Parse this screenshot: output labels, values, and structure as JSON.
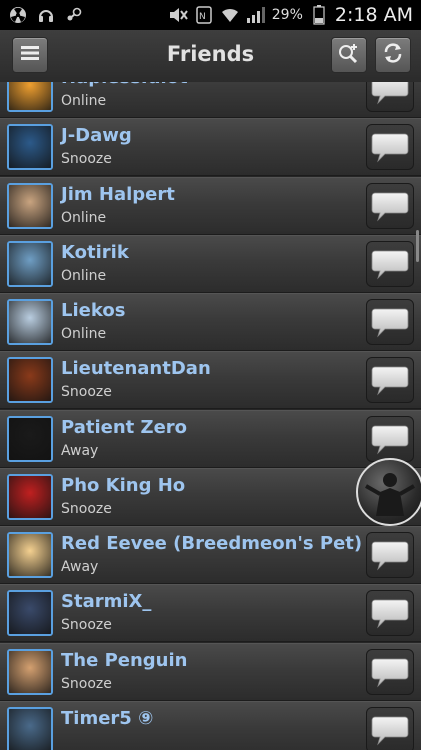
{
  "status_bar": {
    "left_icons": [
      "radiation-icon",
      "headset-icon",
      "steam-icon"
    ],
    "right_icons": [
      "mute-icon",
      "nfc-icon",
      "wifi-icon",
      "signal-icon"
    ],
    "battery_percent": "29%",
    "time": "2:18 AM"
  },
  "app_bar": {
    "title": "Friends",
    "menu_icon": "menu-icon",
    "search_add_icon": "search-add-icon",
    "refresh_icon": "refresh-icon"
  },
  "friends": [
    {
      "name": "HaplessIdiot",
      "status": "Online",
      "avatar_color": "#f0a030"
    },
    {
      "name": "J-Dawg",
      "status": "Snooze",
      "avatar_color": "#2c5a8a"
    },
    {
      "name": "Jim Halpert",
      "status": "Online",
      "avatar_color": "#c9a480"
    },
    {
      "name": "Kotirik",
      "status": "Online",
      "avatar_color": "#6f9ec4"
    },
    {
      "name": "Liekos",
      "status": "Online",
      "avatar_color": "#b9cde0"
    },
    {
      "name": "LieutenantDan",
      "status": "Snooze",
      "avatar_color": "#8a3a1a"
    },
    {
      "name": "Patient Zero",
      "status": "Away",
      "avatar_color": "#1a1a1a"
    },
    {
      "name": "Pho King Ho",
      "status": "Snooze",
      "avatar_color": "#c02020"
    },
    {
      "name": "Red Eevee (Breedmeon's Pet)",
      "status": "Away",
      "avatar_color": "#f4d090"
    },
    {
      "name": "StarmiX_",
      "status": "Snooze",
      "avatar_color": "#3a4a6a"
    },
    {
      "name": "The Penguin",
      "status": "Snooze",
      "avatar_color": "#d4a070"
    },
    {
      "name": "Timer5 ⑨",
      "status": "",
      "avatar_color": "#4a6a8a"
    }
  ],
  "chat_button_icon": "chat-bubble-icon"
}
